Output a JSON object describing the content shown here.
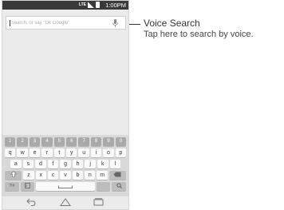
{
  "status_bar": {
    "network": "LTE",
    "time": "1:00PM"
  },
  "search": {
    "placeholder": "Search, or say \"Ok Google\""
  },
  "keyboard": {
    "number_row": [
      "1",
      "2",
      "3",
      "4",
      "5",
      "6",
      "7",
      "8",
      "9",
      "0"
    ],
    "row1": [
      "q",
      "w",
      "e",
      "r",
      "t",
      "y",
      "u",
      "i",
      "o",
      "p"
    ],
    "row2": [
      "a",
      "s",
      "d",
      "f",
      "g",
      "h",
      "j",
      "k",
      "l"
    ],
    "row3": [
      "z",
      "x",
      "c",
      "v",
      "b",
      "n",
      "m"
    ],
    "symbols_key": "?!#",
    "shift_icon": "shift-icon",
    "backspace_icon": "backspace-icon",
    "search_icon": "search-icon"
  },
  "callout": {
    "title": "Voice Search",
    "description": "Tap here to search by voice."
  }
}
